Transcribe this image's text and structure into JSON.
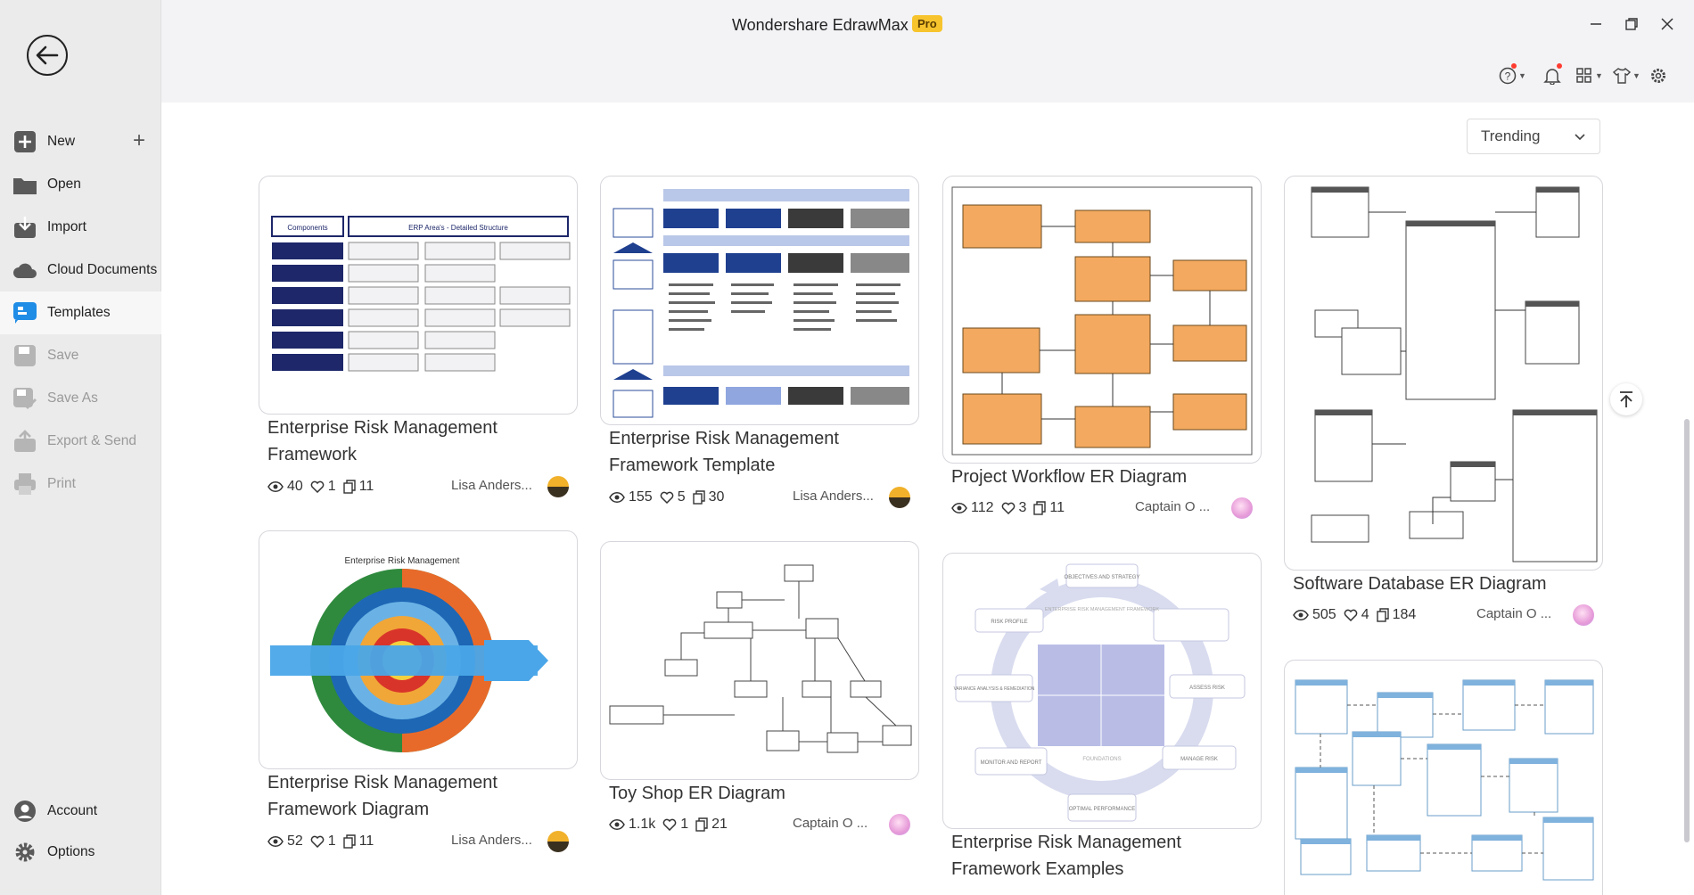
{
  "app": {
    "title": "Wondershare EdrawMax",
    "badge": "Pro"
  },
  "sidebar": {
    "items": [
      {
        "label": "New",
        "icon": "plus-square-icon",
        "disabled": false
      },
      {
        "label": "Open",
        "icon": "folder-icon",
        "disabled": false
      },
      {
        "label": "Import",
        "icon": "import-icon",
        "disabled": false
      },
      {
        "label": "Cloud Documents",
        "icon": "cloud-icon",
        "disabled": false
      },
      {
        "label": "Templates",
        "icon": "templates-icon",
        "disabled": false,
        "active": true
      },
      {
        "label": "Save",
        "icon": "save-icon",
        "disabled": true
      },
      {
        "label": "Save As",
        "icon": "save-as-icon",
        "disabled": true
      },
      {
        "label": "Export & Send",
        "icon": "export-icon",
        "disabled": true
      },
      {
        "label": "Print",
        "icon": "print-icon",
        "disabled": true
      }
    ],
    "bottom": [
      {
        "label": "Account",
        "icon": "account-icon"
      },
      {
        "label": "Options",
        "icon": "gear-icon"
      }
    ]
  },
  "sort": {
    "selected": "Trending"
  },
  "cards": [
    {
      "title": "Enterprise Risk Management Framework",
      "views": "40",
      "likes": "1",
      "copies": "11",
      "author": "Lisa Anders..."
    },
    {
      "title": "Enterprise Risk Management Framework Template",
      "views": "155",
      "likes": "5",
      "copies": "30",
      "author": "Lisa Anders..."
    },
    {
      "title": "Project Workflow ER Diagram",
      "views": "112",
      "likes": "3",
      "copies": "11",
      "author": "Captain O ..."
    },
    {
      "title": "Software Database ER Diagram",
      "views": "505",
      "likes": "4",
      "copies": "184",
      "author": "Captain O ..."
    },
    {
      "title": "Enterprise Risk Management Framework Diagram",
      "views": "52",
      "likes": "1",
      "copies": "11",
      "author": "Lisa Anders..."
    },
    {
      "title": "Toy Shop ER Diagram",
      "views": "1.1k",
      "likes": "1",
      "copies": "21",
      "author": "Captain O ..."
    },
    {
      "title": "Enterprise Risk Management Framework Examples",
      "views": "",
      "likes": "",
      "copies": "",
      "author": ""
    }
  ],
  "thumb_text": {
    "erm_framework": {
      "components": "Components",
      "header": "ERP Area's - Detailed Structure"
    },
    "erm_diagram": {
      "title": "Enterprise Risk Management"
    },
    "erm_examples": {
      "center": "ENTERPRISE RISK MANAGEMENT FRAMEWORK",
      "top": "OBJECTIVES AND STRATEGY",
      "left": "RISK PROFILE",
      "assess": "ASSESS RISK",
      "manage": "MANAGE RISK",
      "monitor": "MONITOR AND REPORT",
      "optimal": "OPTIMAL PERFORMANCE",
      "variance": "VARIANCE ANALYSIS & REMEDIATION",
      "foundations": "FOUNDATIONS"
    }
  }
}
